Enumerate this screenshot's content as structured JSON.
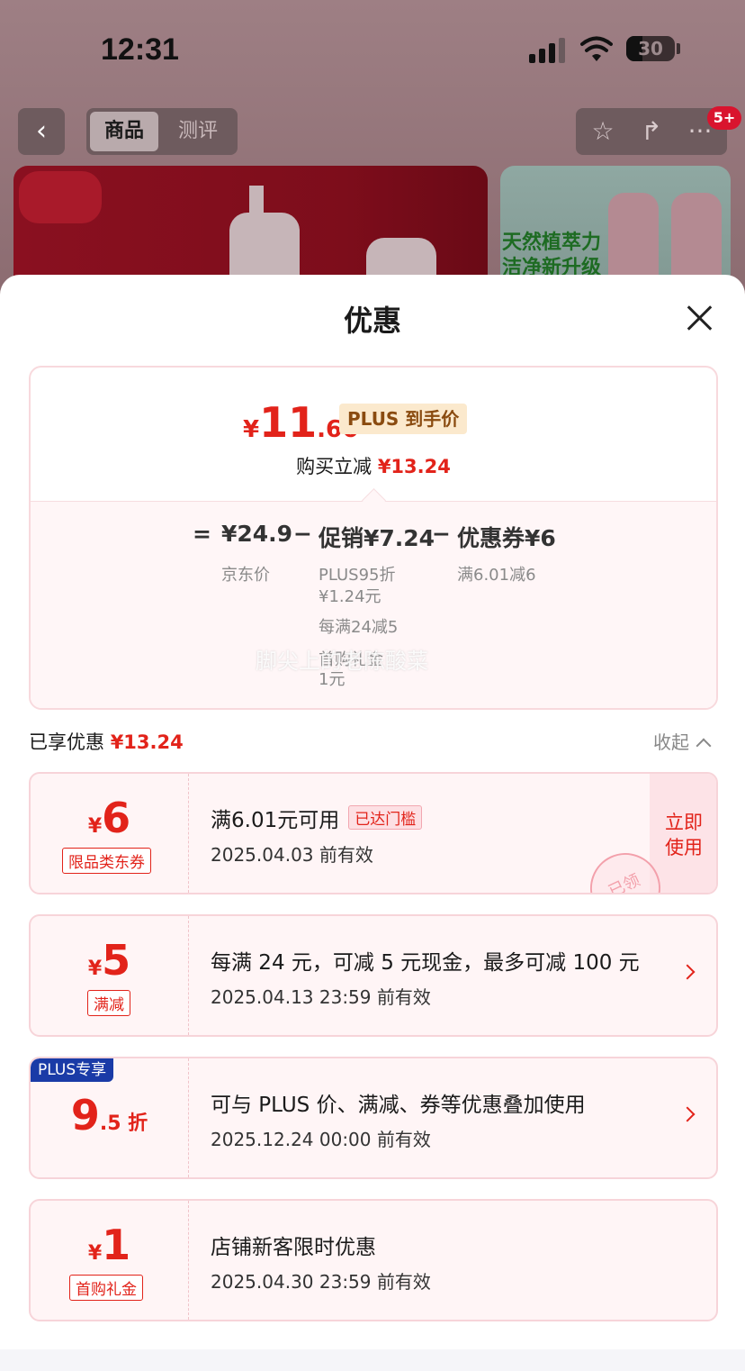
{
  "status": {
    "time": "12:31",
    "battery": "30"
  },
  "nav": {
    "back_icon": "chevron-left-icon",
    "tabs": [
      {
        "label": "商品",
        "active": true
      },
      {
        "label": "测评",
        "active": false
      }
    ],
    "tools": [
      "star-icon",
      "share-icon",
      "more-icon"
    ],
    "more_badge": "5+"
  },
  "banner": {
    "right_text_1": "天然植萃力",
    "right_text_2": "洁净新升级"
  },
  "sheet": {
    "title": "优惠",
    "summary": {
      "price_currency": "¥",
      "price_int": "11",
      "price_dec": ".66",
      "price_tag": "PLUS 到手价",
      "instant_label": "购买立减",
      "instant_amount": "¥13.24",
      "equals": "=",
      "jd_price": "¥24.9",
      "jd_price_label": "京东价",
      "minus": "−",
      "promo": "促销¥7.24",
      "promo_details": [
        "PLUS95折",
        "¥1.24元",
        "每满24减5",
        "首购礼金",
        "1元"
      ],
      "coupon": "优惠券¥6",
      "coupon_detail": "满6.01减6",
      "watermark": "脚尖上的老陈酸菜"
    },
    "enjoyed_label": "已享优惠",
    "enjoyed_amount": "¥13.24",
    "collapse_label": "收起",
    "coupons": [
      {
        "currency": "¥",
        "amount": "6",
        "tag": "限品类东券",
        "line1": "满6.01元可用",
        "reached": "已达门槛",
        "line2": "2025.04.03 前有效",
        "action": [
          "立即",
          "使用"
        ],
        "stamp": "已领"
      },
      {
        "currency": "¥",
        "amount": "5",
        "tag": "满减",
        "line1": "每满 24 元，可减 5 元现金，最多可减 100 元",
        "line2": "2025.04.13 23:59 前有效"
      },
      {
        "badge": "PLUS专享",
        "amount_main": "9",
        "amount_sub": ".5 折",
        "line1": "可与 PLUS 价、满减、券等优惠叠加使用",
        "line2": "2025.12.24 00:00 前有效"
      },
      {
        "currency": "¥",
        "amount": "1",
        "tag": "首购礼金",
        "line1": "店铺新客限时优惠",
        "line2": "2025.04.30 23:59 前有效"
      }
    ]
  }
}
